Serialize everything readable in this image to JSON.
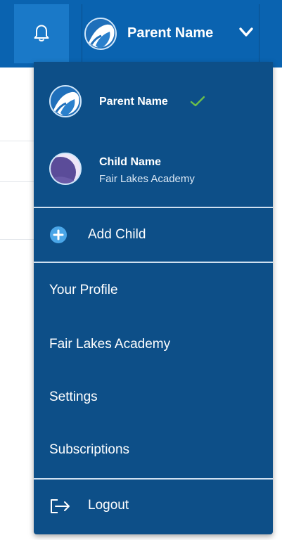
{
  "header": {
    "user_name": "Parent Name",
    "icons": {
      "notifications": "bell-icon",
      "avatar": "parent-avatar-icon",
      "expand": "chevron-down-icon"
    }
  },
  "dropdown": {
    "accounts": [
      {
        "name": "Parent Name",
        "selected": true,
        "icon": "check-icon"
      },
      {
        "name": "Child Name",
        "school": "Fair Lakes Academy"
      }
    ],
    "add_child_label": "Add Child",
    "menu_items": [
      {
        "label": "Your Profile"
      },
      {
        "label": "Fair Lakes Academy"
      },
      {
        "label": "Settings"
      },
      {
        "label": "Subscriptions"
      }
    ],
    "logout_label": "Logout"
  },
  "colors": {
    "topbar": "#0a63b0",
    "bell_button": "#1a79c8",
    "dropdown_bg": "#0d4f88",
    "separator": "#cfe0f0",
    "check": "#6cc04a",
    "plus_circle": "#4aa6e8"
  }
}
